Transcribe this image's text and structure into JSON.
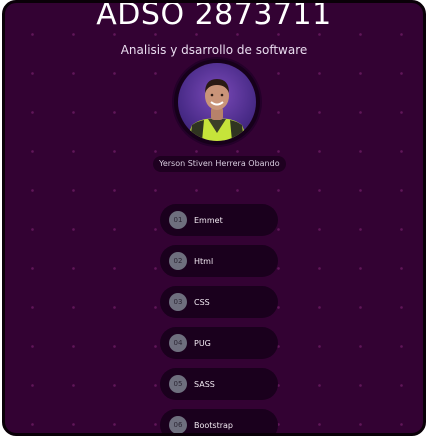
{
  "header": {
    "title": "ADSO 2873711",
    "subtitle": "Analisis y dsarrollo de software"
  },
  "profile": {
    "name": "Yerson Stiven Herrera Obando"
  },
  "menu": [
    {
      "number": "01",
      "label": "Emmet"
    },
    {
      "number": "02",
      "label": "Html"
    },
    {
      "number": "03",
      "label": "CSS"
    },
    {
      "number": "04",
      "label": "PUG"
    },
    {
      "number": "05",
      "label": "SASS"
    },
    {
      "number": "06",
      "label": "Bootstrap"
    }
  ],
  "colors": {
    "background": "#330233",
    "button": "#1a001d",
    "number_badge": "#6e6f7e"
  }
}
